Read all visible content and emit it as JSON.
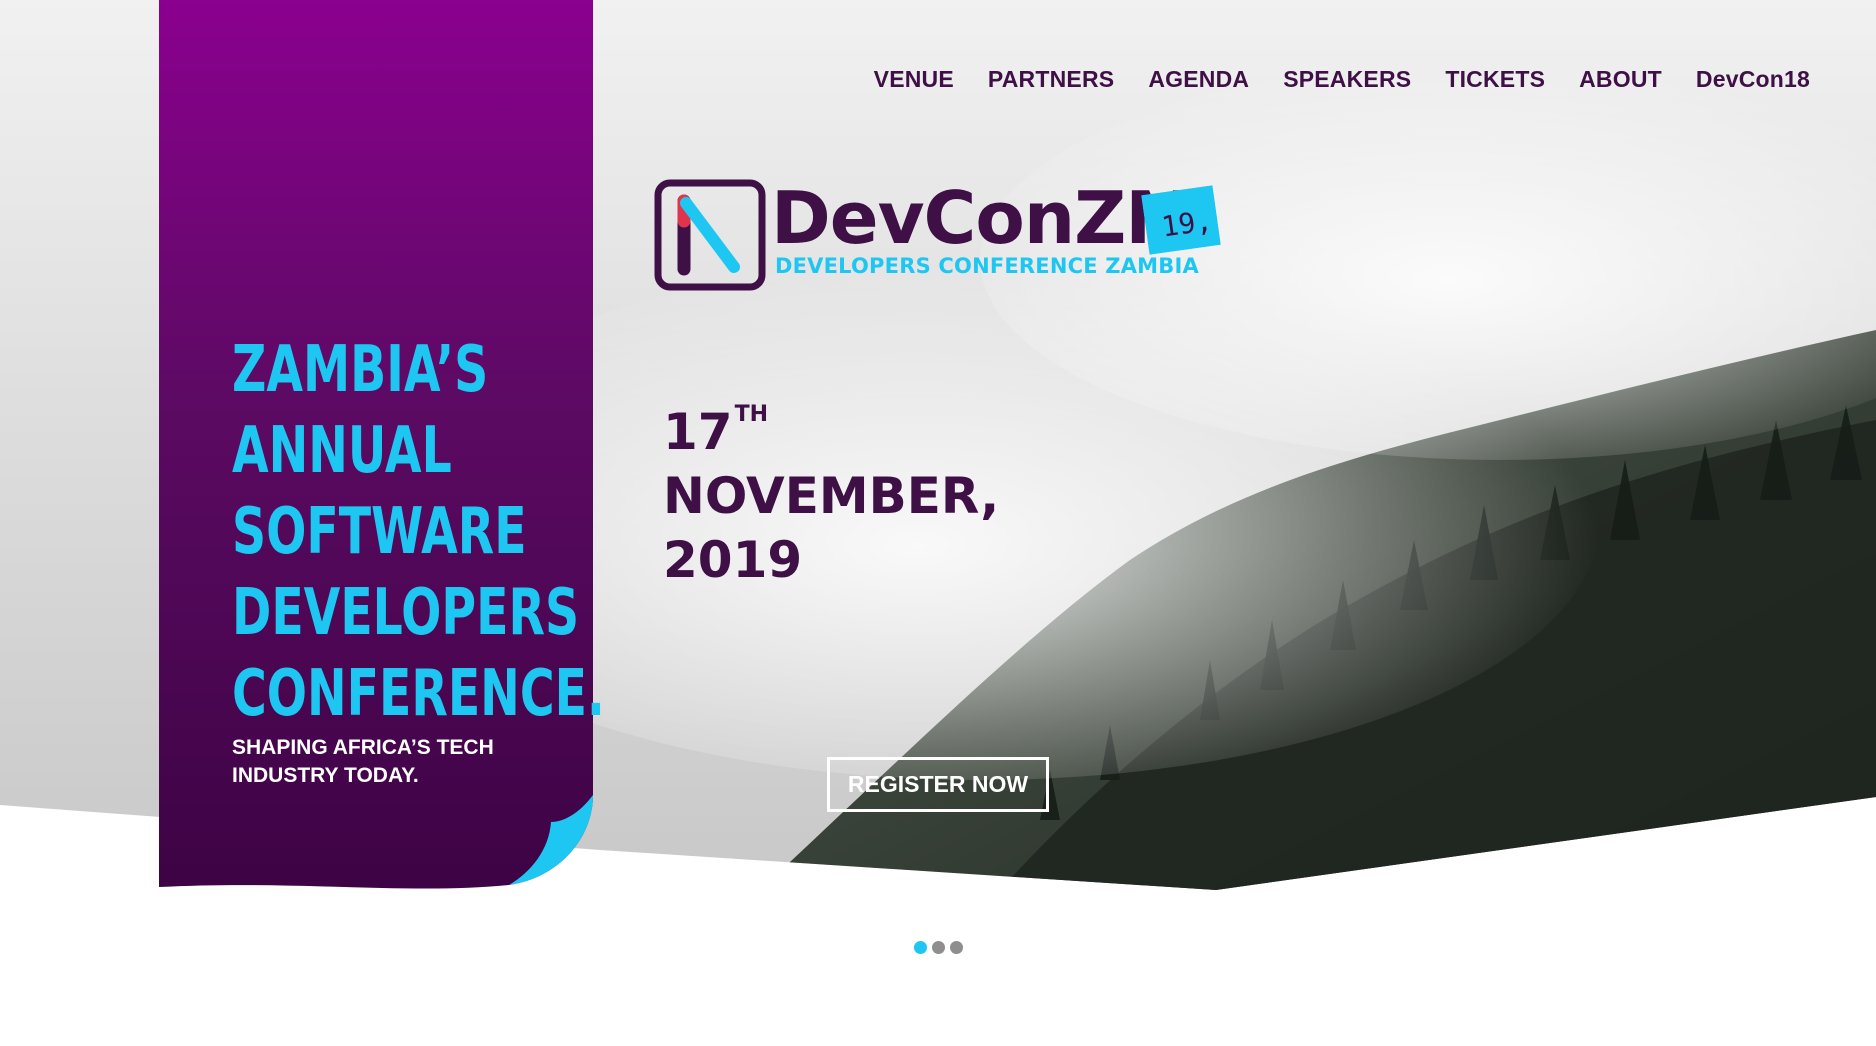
{
  "nav": {
    "items": [
      {
        "label": "VENUE"
      },
      {
        "label": "PARTNERS"
      },
      {
        "label": "AGENDA"
      },
      {
        "label": "SPEAKERS"
      },
      {
        "label": "TICKETS"
      },
      {
        "label": "ABOUT"
      },
      {
        "label": "DevCon18"
      }
    ]
  },
  "logo": {
    "name": "DevConZM",
    "year_tag": "19,",
    "subtitle": "DEVELOPERS CONFERENCE ZAMBIA"
  },
  "banner": {
    "tagline_lines": [
      "ZAMBIA’S",
      "ANNUAL",
      "SOFTWARE",
      "DEVELOPERS",
      "CONFERENCE."
    ],
    "subtagline": "SHAPING AFRICA’S TECH INDUSTRY TODAY."
  },
  "event_date": {
    "day": "17",
    "suffix": "TH",
    "month": "NOVEMBER,",
    "year": "2019"
  },
  "cta": {
    "register_label": "REGISTER NOW"
  },
  "carousel": {
    "slide_count": 3,
    "active_index": 0
  },
  "colors": {
    "purple_dark": "#3e1046",
    "purple_light": "#8b008f",
    "cyan": "#1ec7f2",
    "white": "#ffffff"
  }
}
